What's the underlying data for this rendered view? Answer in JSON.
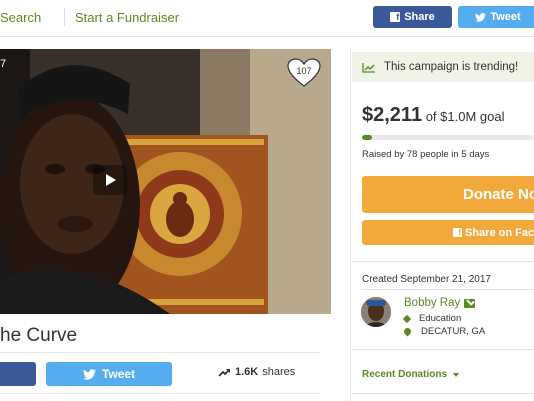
{
  "nav": {
    "search_label": "Search",
    "start_label": "Start a Fundraiser",
    "share_label": "Share",
    "tweet_label": "Tweet"
  },
  "video": {
    "overlay_number": "7",
    "heart_count": "107"
  },
  "campaign": {
    "title": "he Curve",
    "tweet_label": "Tweet",
    "shares_count": "1.6K",
    "shares_label": "shares"
  },
  "sidebar": {
    "trending_text": "This campaign is trending!",
    "amount_raised": "$2,211",
    "goal_text": "of $1.0M goal",
    "progress_fraction": 0.0022,
    "raised_by": "Raised by 78 people in 5 days",
    "donate_label": "Donate No",
    "fb_share_label": "Share on Facel",
    "created": "Created September 21, 2017",
    "organizer_name": "Bobby Ray",
    "category": "Education",
    "location": "DECATUR, GA",
    "recent_donations": "Recent Donations"
  },
  "colors": {
    "accent_green": "#5b8a24",
    "facebook_blue": "#3b5998",
    "twitter_blue": "#55acee",
    "donate_orange": "#f2a93b"
  }
}
